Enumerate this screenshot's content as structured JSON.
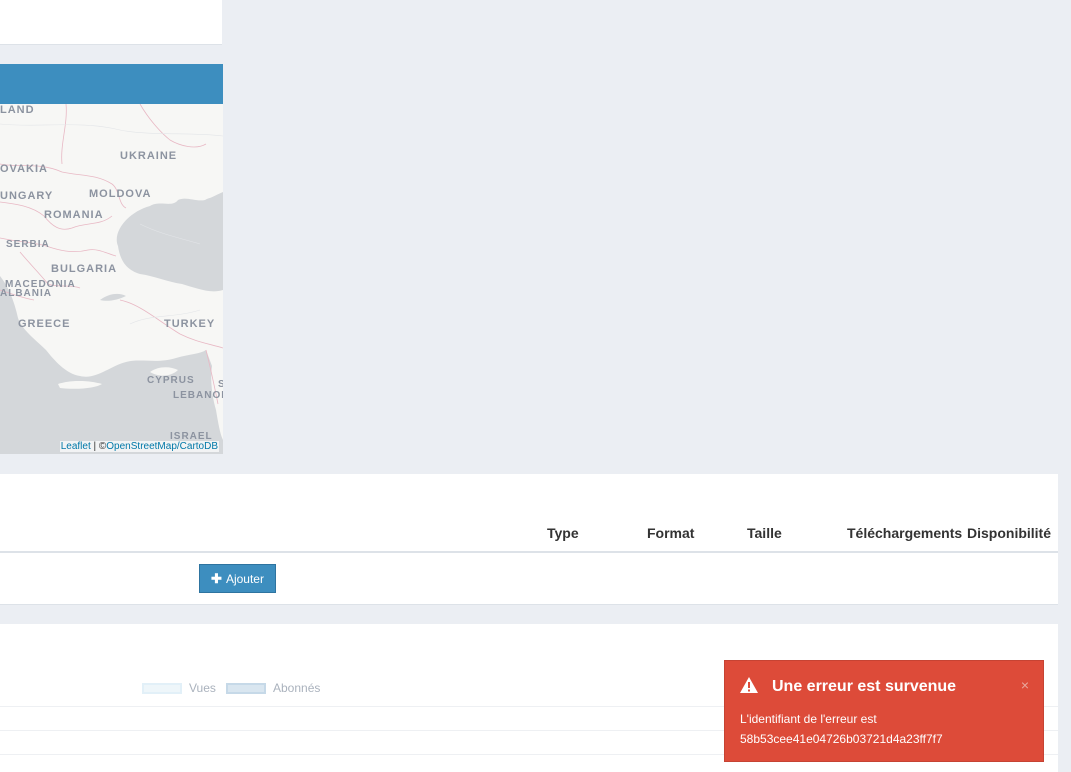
{
  "map": {
    "labels": [
      "LAND",
      "UKRAINE",
      "OVAKIA",
      "MOLDOVA",
      "UNGARY",
      "ROMANIA",
      "SERBIA",
      "BULGARIA",
      "MACEDONIA",
      "ALBANIA",
      "GREECE",
      "TURKEY",
      "CYPRUS",
      "LEBANON",
      "ISRAEL",
      "S"
    ],
    "attribution_leaflet": "Leaflet",
    "attribution_sep": " | ©",
    "attribution_osm": "OpenStreetMap/CartoDB"
  },
  "table": {
    "headers": [
      "Type",
      "Format",
      "Taille",
      "Téléchargements",
      "Disponibilité"
    ],
    "add_button": "Ajouter",
    "header_color": "#3d8ebf"
  },
  "chart": {
    "legend": [
      "Vues",
      "Abonnés"
    ]
  },
  "toast": {
    "title": "Une erreur est survenue",
    "message_line1": "L'identifiant de l'erreur est",
    "message_line2": "58b53cee41e04726b03721d4a23ff7f7",
    "close": "×",
    "icon": "warning-icon",
    "color": "#dd4b39"
  }
}
